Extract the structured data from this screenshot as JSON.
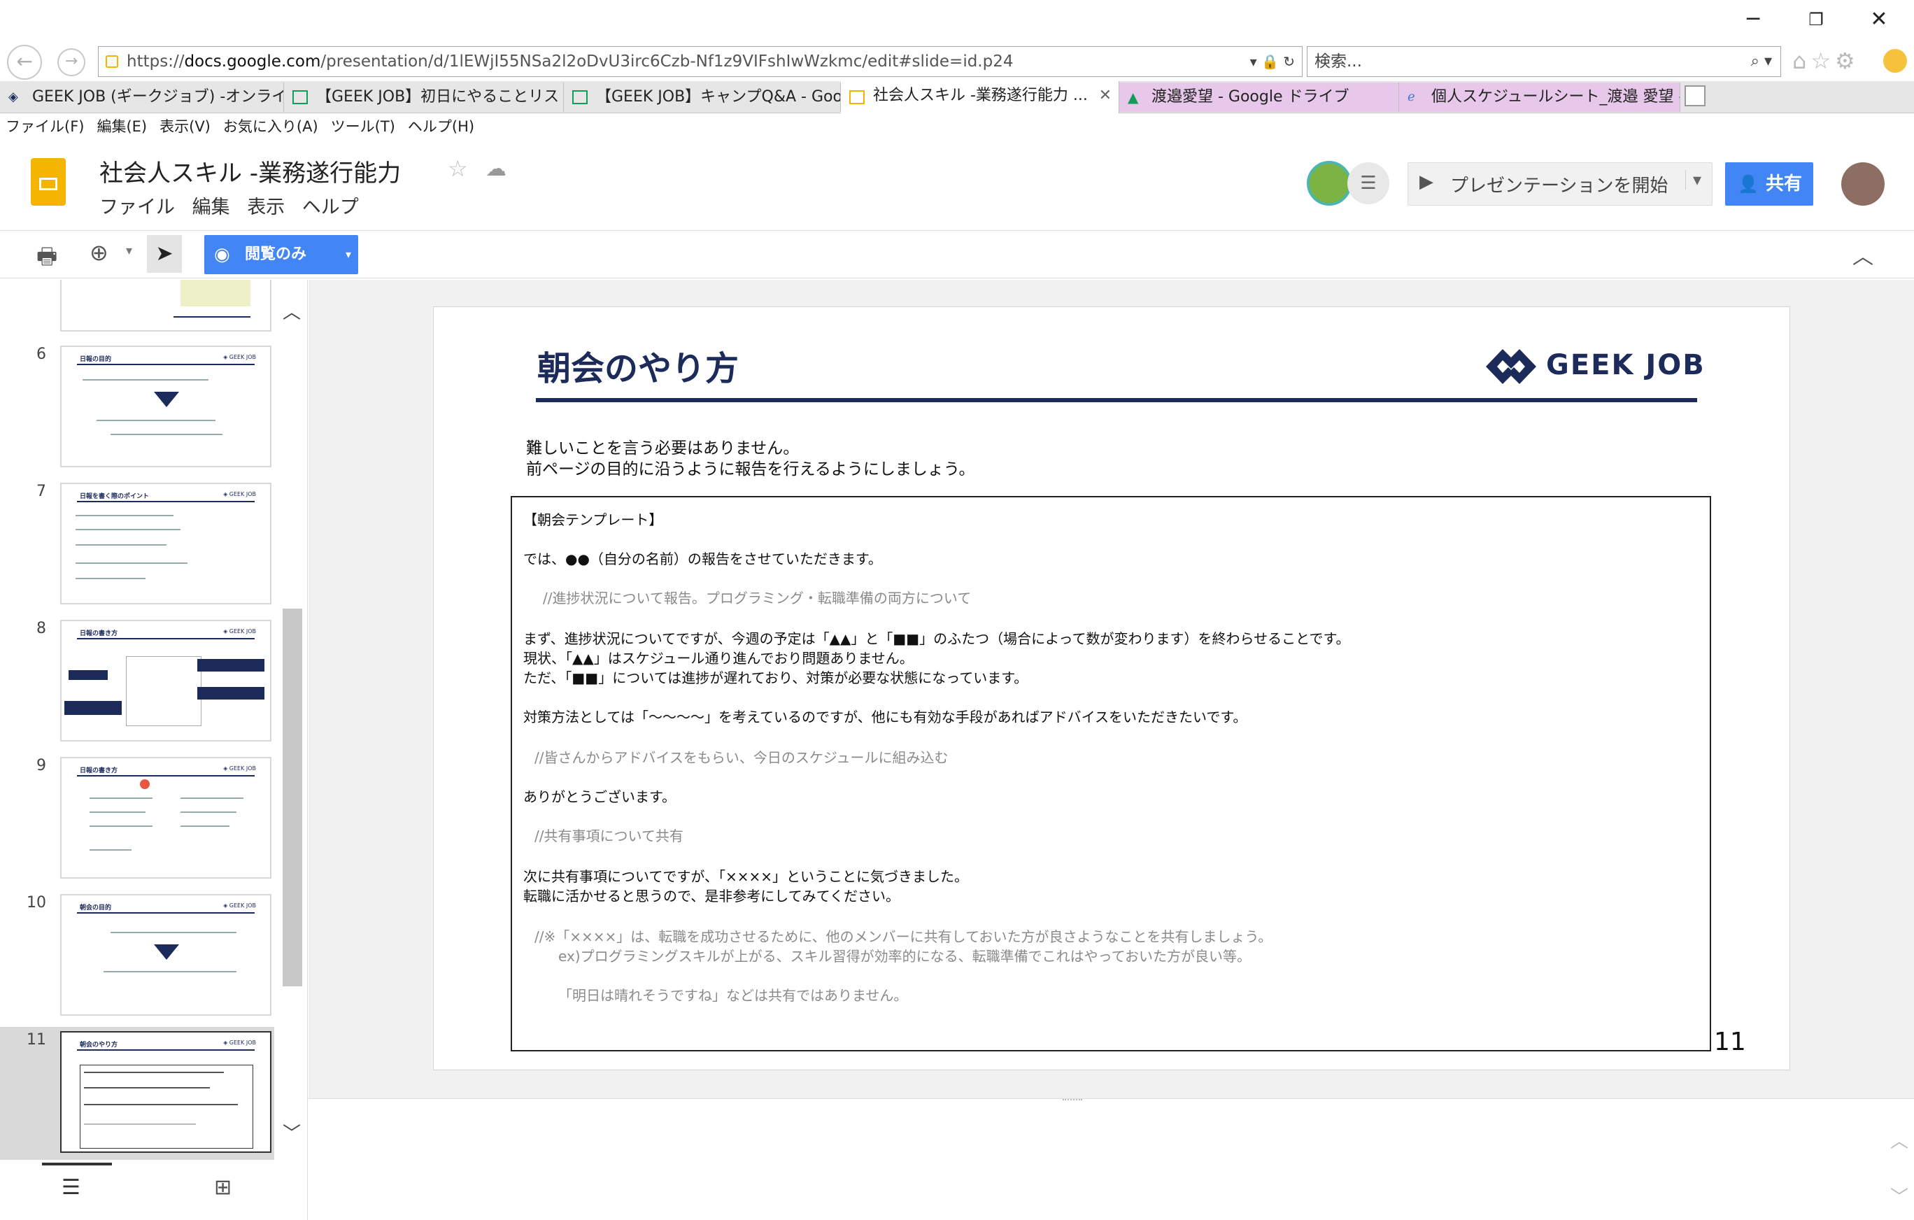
{
  "browser": {
    "url_prefix": "https://",
    "url_domain": "docs.google.com",
    "url_path": "/presentation/d/1lEWjI55NSa2l2oDvU3irc6Czb-Nf1z9VIFshIwWzkmc/edit#slide=id.p24",
    "search_placeholder": "検索...",
    "tabs": [
      {
        "label": "GEEK JOB (ギークジョブ) -オンライン..."
      },
      {
        "label": "【GEEK JOB】初日にやることリスト -..."
      },
      {
        "label": "【GEEK JOB】キャンプQ&A - Googl..."
      },
      {
        "label": "社会人スキル -業務遂行能力 ..."
      },
      {
        "label": "渡邉愛望 - Google ドライブ"
      },
      {
        "label": "個人スケジュールシート_渡邉 愛望 -..."
      }
    ],
    "menu": [
      "ファイル(F)",
      "編集(E)",
      "表示(V)",
      "お気に入り(A)",
      "ツール(T)",
      "ヘルプ(H)"
    ]
  },
  "doc": {
    "title": "社会人スキル -業務遂行能力",
    "menu": [
      "ファイル",
      "編集",
      "表示",
      "ヘルプ"
    ],
    "present_label": "プレゼンテーションを開始",
    "share_label": "共有",
    "view_mode_label": "閲覧のみ"
  },
  "filmstrip": {
    "thumbs": [
      {
        "num": "6",
        "title": "日報の目的"
      },
      {
        "num": "7",
        "title": "日報を書く際のポイント"
      },
      {
        "num": "8",
        "title": "日報の書き方"
      },
      {
        "num": "9",
        "title": "日報の書き方"
      },
      {
        "num": "10",
        "title": "朝会の目的"
      },
      {
        "num": "11",
        "title": "朝会のやり方"
      }
    ]
  },
  "slide": {
    "title": "朝会のやり方",
    "logo_text": "GEEK JOB",
    "intro_line1": "難しいことを言う必要はありません。",
    "intro_line2": "前ページの目的に沿うように報告を行えるようにしましょう。",
    "page_number": "11",
    "template": {
      "heading": "【朝会テンプレート】",
      "l1": "では、●●（自分の名前）の報告をさせていただきます。",
      "c1": "//進捗状況について報告。プログラミング・転職準備の両方について",
      "l2": "まず、進捗状況についてですが、今週の予定は「▲▲」と「■■」のふたつ（場合によって数が変わります）を終わらせることです。",
      "l3": "現状、「▲▲」はスケジュール通り進んでおり問題ありません。",
      "l4": "ただ、「■■」については進捗が遅れており、対策が必要な状態になっています。",
      "l5": "対策方法としては「～～～～」を考えているのですが、他にも有効な手段があればアドバイスをいただきたいです。",
      "c2": "//皆さんからアドバイスをもらい、今日のスケジュールに組み込む",
      "l6": "ありがとうございます。",
      "c3": "//共有事項について共有",
      "l7": "次に共有事項についてですが、「××××」ということに気づきました。",
      "l8": "転職に活かせると思うので、是非参考にしてみてください。",
      "c4": "//※「××××」は、転職を成功させるために、他のメンバーに共有しておいた方が良さようなことを共有しましょう。",
      "c5": "ex)プログラミングスキルが上がる、スキル習得が効率的になる、転職準備でこれはやっておいた方が良い等。",
      "c6": "「明日は晴れそうですね」などは共有ではありません。"
    }
  },
  "colors": {
    "navy": "#1c2b5a",
    "accent_blue": "#4285f4",
    "slides_yellow": "#f4b400"
  }
}
